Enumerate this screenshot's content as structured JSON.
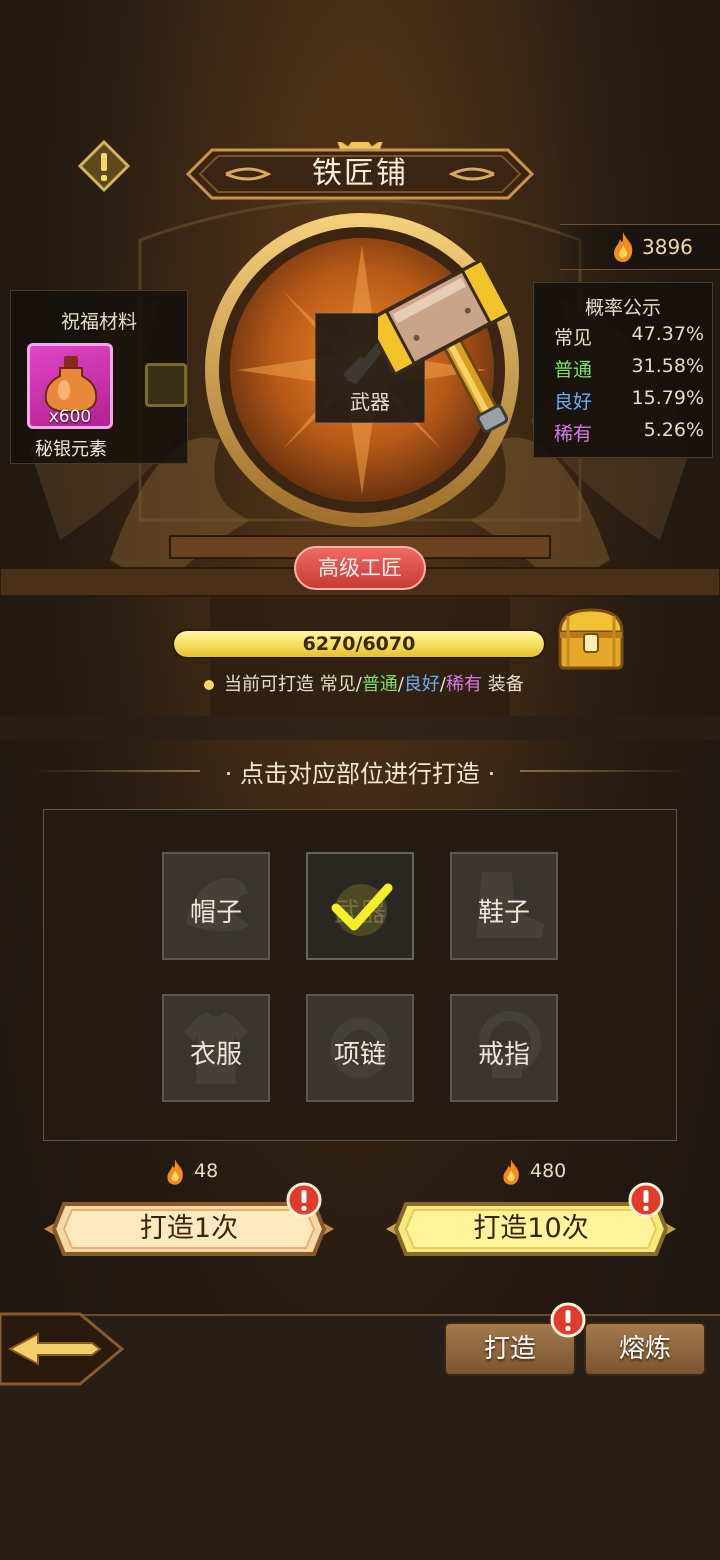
{
  "header": {
    "title": "铁匠铺"
  },
  "currency": {
    "icon": "flame-icon",
    "value": "3896"
  },
  "bless": {
    "title": "祝福材料",
    "item_icon": "potion-bottle-icon",
    "item_qty": "x600",
    "item_name": "秘银元素"
  },
  "probability": {
    "title": "概率公示",
    "rows": [
      {
        "name": "常见",
        "percent": "47.37%",
        "color": "#e8dcc4"
      },
      {
        "name": "普通",
        "percent": "31.58%",
        "color": "#7ee06a"
      },
      {
        "name": "良好",
        "percent": "15.79%",
        "color": "#6aaef5"
      },
      {
        "name": "稀有",
        "percent": "5.26%",
        "color": "#d77ae6"
      }
    ]
  },
  "current_part": {
    "label": "武器",
    "icon": "hammer-icon"
  },
  "rank": {
    "label": "高级工匠"
  },
  "progress": {
    "text": "6270/6070",
    "current": 6270,
    "max": 6070,
    "fill": 1.0
  },
  "tip": {
    "prefix": "当前可打造",
    "tiers": [
      "常见",
      "普通",
      "良好",
      "稀有"
    ],
    "tier_colors": [
      "#e8dcc4",
      "#7ee06a",
      "#6aaef5",
      "#d77ae6"
    ],
    "sep": "/",
    "suffix": "装备"
  },
  "section": {
    "title": "· 点击对应部位进行打造 ·"
  },
  "slots": [
    {
      "label": "帽子",
      "selected": false
    },
    {
      "label": "武器",
      "selected": true
    },
    {
      "label": "鞋子",
      "selected": false
    },
    {
      "label": "衣服",
      "selected": false
    },
    {
      "label": "项链",
      "selected": false
    },
    {
      "label": "戒指",
      "selected": false
    }
  ],
  "forge": {
    "once": {
      "cost": "48",
      "label": "打造1次"
    },
    "ten": {
      "cost": "480",
      "label": "打造10次"
    }
  },
  "tabs": {
    "forge": "打造",
    "smelt": "熔炼"
  },
  "colors": {
    "gold": "#f7e163",
    "accent_red": "#e23b2c"
  }
}
